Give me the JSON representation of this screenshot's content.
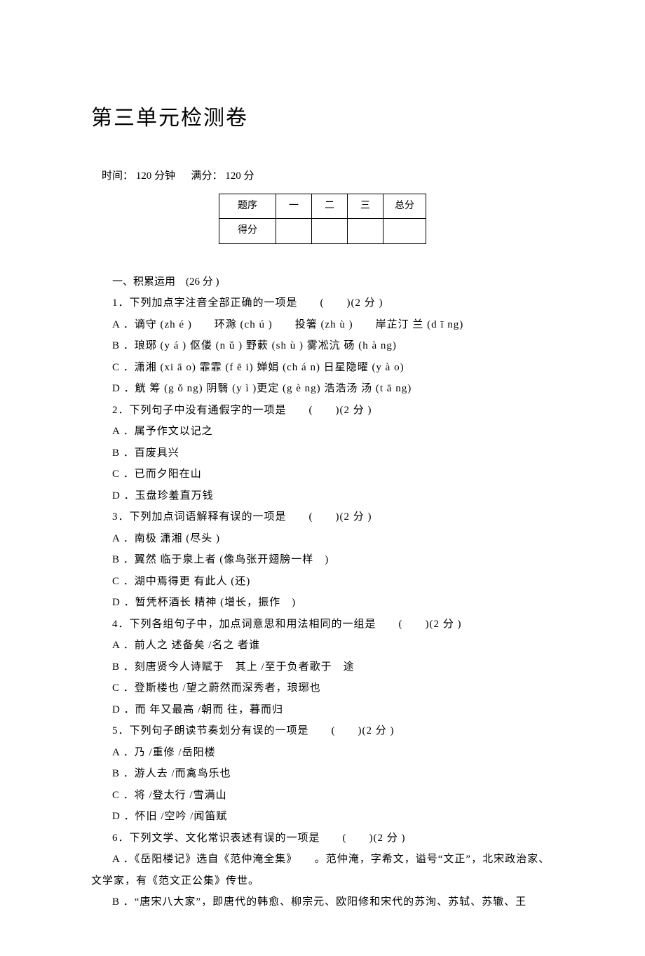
{
  "title": "第三单元检测卷",
  "time_label": "时间：",
  "time_value": "120 分钟",
  "full_label": "满分：",
  "full_value": "120 分",
  "table": {
    "row1": [
      "题序",
      "一",
      "二",
      "三",
      "总分"
    ],
    "row2_label": "得分"
  },
  "section1": "一、积累运用　(26 分 )",
  "q1": "1．下列加点字注音全部正确的一项是　　(　　)(2 分 )",
  "q1A": "A ．谪守 (zh é )　　环滁 (ch ú )　　投箸 (zh ù )　　岸芷汀 兰 (d ī ng)",
  "q1B": "B ．琅琊 (y á ) 伛偻 (n ǔ ) 野蔌 (sh ù ) 雾凇沆 砀 (h à ng)",
  "q1C": "C ．潇湘 (xi ā o) 霏霏 (f ē i) 婵娟 (ch á n) 日星隐曜 (y à o)",
  "q1D": "D ．觥 筹 (g ǒ ng) 阴翳 (y ì )更定 (g è ng) 浩浩汤 汤 (t ā ng)",
  "q2": "2．下列句子中没有通假字的一项是　　(　　)(2 分 )",
  "q2A": "A ．属予作文以记之",
  "q2B": "B ．百废具兴",
  "q2C": "C ．已而夕阳在山",
  "q2D": "D ．玉盘珍羞直万钱",
  "q3": "3．下列加点词语解释有误的一项是　　(　　)(2 分 )",
  "q3A": "A ．南极 潇湘 (尽头 )",
  "q3B": "B ．翼然 临于泉上者 (像鸟张开翅膀一样　)",
  "q3C": "C ．湖中焉得更 有此人 (还)",
  "q3D": "D ．暂凭杯酒长 精神 (增长，振作　)",
  "q4": "4．下列各组句子中，加点词意思和用法相同的一组是　　(　　)(2 分 )",
  "q4A": "A ．前人之 述备矣 /名之 者谁",
  "q4B": "B ．刻唐贤今人诗赋于　其上 /至于负者歌于　途",
  "q4C": "C ．登斯楼也 /望之蔚然而深秀者，琅琊也",
  "q4D": "D ．而 年又最高 /朝而 往，暮而归",
  "q5": "5．下列句子朗读节奏划分有误的一项是　　(　　)(2 分 )",
  "q5A": "A ．乃 /重修 /岳阳楼",
  "q5B": "B ．游人去 /而禽鸟乐也",
  "q5C": "C ．将 /登太行 /雪满山",
  "q5D": "D ．怀旧 /空吟 /闻笛赋",
  "q6": "6．下列文学、文化常识表述有误的一项是　　(　　)(2 分 )",
  "q6A_a": "A ．《岳阳楼记》选自《范仲淹全集》　　。范仲淹，字希文，谥号“文正”，北宋政治家、",
  "q6A_b": "文学家，有《范文正公集》传世。",
  "q6B": "B ．“唐宋八大家”，即唐代的韩愈、柳宗元、欧阳修和宋代的苏洵、苏轼、苏辙、王"
}
